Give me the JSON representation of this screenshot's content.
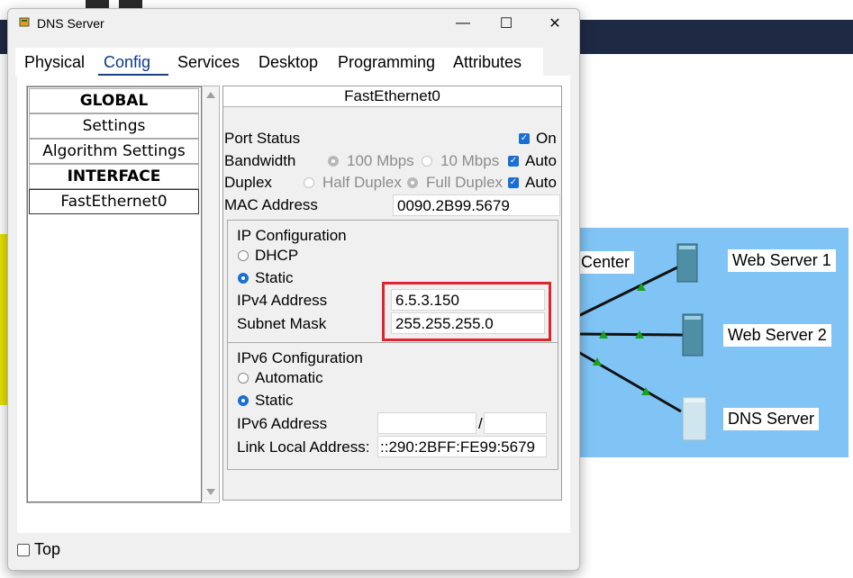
{
  "window": {
    "title": "DNS Server",
    "minimize": "—",
    "maximize": "☐",
    "close": "✕"
  },
  "tabs": [
    {
      "label": "Physical"
    },
    {
      "label": "Config"
    },
    {
      "label": "Services"
    },
    {
      "label": "Desktop"
    },
    {
      "label": "Programming"
    },
    {
      "label": "Attributes"
    }
  ],
  "active_tab": "Config",
  "sidebar": {
    "items": [
      {
        "label": "GLOBAL"
      },
      {
        "label": "Settings"
      },
      {
        "label": "Algorithm Settings"
      },
      {
        "label": "INTERFACE"
      },
      {
        "label": "FastEthernet0"
      }
    ]
  },
  "interface": {
    "header": "FastEthernet0",
    "port_status_label": "Port Status",
    "port_on_label": "On",
    "bandwidth_label": "Bandwidth",
    "bw_100": "100 Mbps",
    "bw_10": "10 Mbps",
    "bw_auto": "Auto",
    "duplex_label": "Duplex",
    "half_duplex": "Half Duplex",
    "full_duplex": "Full Duplex",
    "duplex_auto": "Auto",
    "mac_label": "MAC Address",
    "mac_value": "0090.2B99.5679"
  },
  "ipv4": {
    "title": "IP Configuration",
    "dhcp": "DHCP",
    "static": "Static",
    "address_label": "IPv4 Address",
    "address_value": "6.5.3.150",
    "mask_label": "Subnet Mask",
    "mask_value": "255.255.255.0"
  },
  "ipv6": {
    "title": "IPv6 Configuration",
    "automatic": "Automatic",
    "static": "Static",
    "address_label": "IPv6 Address",
    "address_value": "",
    "prefix_sep": "/",
    "prefix_value": "",
    "link_local_label": "Link Local Address:",
    "link_local_value": "::290:2BFF:FE99:5679"
  },
  "footer": {
    "top_label": "Top"
  },
  "background": {
    "center_label": "Center",
    "web1_label": "Web Server 1",
    "web2_label": "Web Server 2",
    "dns_label": "DNS Server"
  }
}
